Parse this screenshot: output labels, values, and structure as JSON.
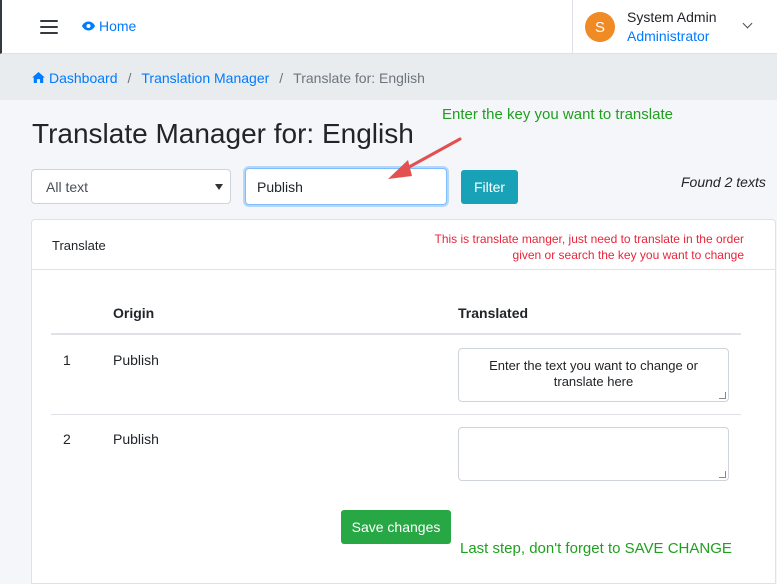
{
  "navbar": {
    "home_label": "Home",
    "user_initial": "S",
    "user_name": "System Admin",
    "user_role": "Administrator"
  },
  "breadcrumb": {
    "items": [
      "Dashboard",
      "Translation Manager"
    ],
    "current": "Translate for: English"
  },
  "page": {
    "title": "Translate Manager for: English"
  },
  "filter": {
    "select_value": "All text",
    "search_value": "Publish",
    "filter_label": "Filter",
    "found_text": "Found 2 texts"
  },
  "card": {
    "title": "Translate",
    "columns": [
      "Origin",
      "Translated"
    ],
    "rows": [
      {
        "index": "1",
        "origin": "Publish",
        "translated": "Enter the text you want to change or translate here"
      },
      {
        "index": "2",
        "origin": "Publish",
        "translated": ""
      }
    ],
    "save_label": "Save changes"
  },
  "annotations": {
    "enter_key": "Enter the key you want to translate",
    "manager_note": "This is translate manger, just need to translate  in the order given or search the key you want to change",
    "last_step": "Last step, don't forget to  SAVE CHANGE"
  },
  "colors": {
    "primary": "#007bff",
    "filter_button": "#17a2b8",
    "save_button": "#28a745",
    "avatar": "#f08a24",
    "annotation_green": "#1fa01f",
    "annotation_red": "#e8263a"
  }
}
